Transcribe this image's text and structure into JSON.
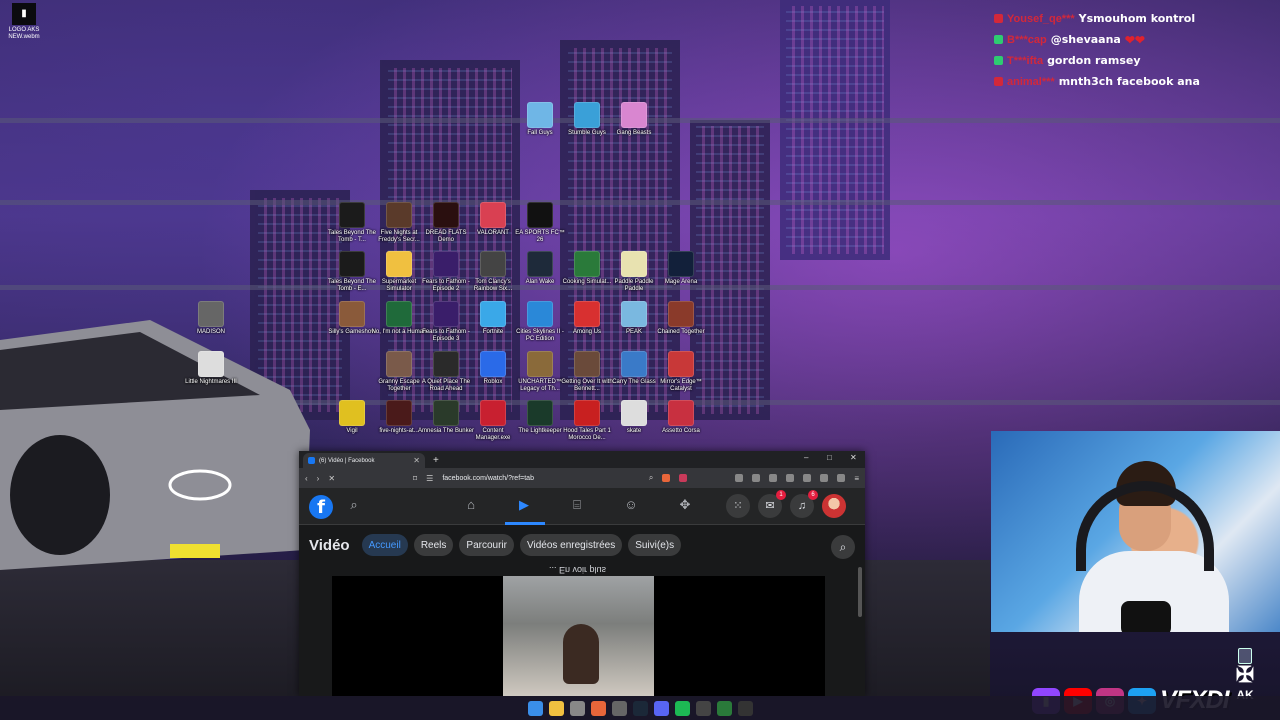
{
  "desktop": {
    "logo_icon_label": "LOGO AKS NEW.webm",
    "icons": [
      {
        "label": "Fall Guys",
        "color": "#6fb6e6"
      },
      {
        "label": "Stumble Guys",
        "color": "#3aa0d8"
      },
      {
        "label": "Gang Beasts",
        "color": "#d986d0"
      },
      {
        "label": "Tales Beyond The Tomb - T...",
        "color": "#1b1b1b"
      },
      {
        "label": "Five Nights at Freddy's Secr...",
        "color": "#5a3a2a"
      },
      {
        "label": "DREAD FLATS Demo",
        "color": "#2a0f0f"
      },
      {
        "label": "VALORANT",
        "color": "#d94052"
      },
      {
        "label": "EA SPORTS FC™ 26",
        "color": "#111"
      },
      {
        "label": "Tales Beyond The Tomb - E...",
        "color": "#1b1b1b"
      },
      {
        "label": "Supermarket Simulator",
        "color": "#f0c040"
      },
      {
        "label": "Fears to Fathom - Episode 2",
        "color": "#3a1e6a"
      },
      {
        "label": "Tom Clancy's Rainbow Six...",
        "color": "#444"
      },
      {
        "label": "Alan Wake",
        "color": "#1e2a3a"
      },
      {
        "label": "Cooking Simulat...",
        "color": "#2a7a3a"
      },
      {
        "label": "Paddle Paddle Paddle",
        "color": "#e8e2b0"
      },
      {
        "label": "Mage Arena",
        "color": "#12203a"
      },
      {
        "label": "MADISON",
        "color": "#666"
      },
      {
        "label": "Silly's Gameshow",
        "color": "#8a5a3a"
      },
      {
        "label": "No, I'm not a Human",
        "color": "#1f6a3a"
      },
      {
        "label": "Fears to Fathom - Episode 3",
        "color": "#3a1e6a"
      },
      {
        "label": "Fortnite",
        "color": "#3aa8e8"
      },
      {
        "label": "Cities Skylines II - PC Edition",
        "color": "#2a88d8"
      },
      {
        "label": "Among Us",
        "color": "#d83030"
      },
      {
        "label": "PEAK",
        "color": "#7ab8e0"
      },
      {
        "label": "Chained Together",
        "color": "#8a3a2a"
      },
      {
        "label": "Little Nightmares III",
        "color": "#ddd"
      },
      {
        "label": "Granny Escape Together",
        "color": "#7a5a4a"
      },
      {
        "label": "A Quiet Place The Road Ahead",
        "color": "#2a2a2a"
      },
      {
        "label": "Roblox",
        "color": "#2a6ae8"
      },
      {
        "label": "UNCHARTED™ Legacy of Th...",
        "color": "#8a6a3a"
      },
      {
        "label": "Getting Over It with Bennett...",
        "color": "#6a4a3a"
      },
      {
        "label": "Carry The Glass",
        "color": "#3a7ac8"
      },
      {
        "label": "Mirror's Edge™ Catalyst",
        "color": "#c83838"
      },
      {
        "label": "Vigil",
        "color": "#e0c020"
      },
      {
        "label": "five-nights-at...",
        "color": "#4a1a1a"
      },
      {
        "label": "Amnesia The Bunker",
        "color": "#2a3a2a"
      },
      {
        "label": "Content Manager.exe",
        "color": "#c82030"
      },
      {
        "label": "The Lightkeeper",
        "color": "#1a3a2a"
      },
      {
        "label": "Hood Tales Part 1 Morocco De...",
        "color": "#c82020"
      },
      {
        "label": "skate",
        "color": "#ddd"
      },
      {
        "label": "Assetto Corsa",
        "color": "#c83040"
      }
    ]
  },
  "chat": {
    "lines": [
      {
        "user": "Yousef_qe***",
        "message": "Ysmouhom kontrol",
        "emote": ""
      },
      {
        "user": "B***cap",
        "message": "@shevaana",
        "emote": "❤❤"
      },
      {
        "user": "T***ifta",
        "message": "gordon ramsey",
        "emote": ""
      },
      {
        "user": "animal***",
        "message": "mnth3ch facebook ana",
        "emote": ""
      }
    ]
  },
  "browser": {
    "tab_title": "(6) Vidéo | Facebook",
    "new_tab": "+",
    "url": "facebook.com/watch/?ref=tab",
    "window_controls": {
      "minimize": "–",
      "maximize": "□",
      "close": "✕"
    },
    "nav_badges": {
      "messenger": "1",
      "notifications": "6"
    }
  },
  "facebook": {
    "logo": "f",
    "video_title": "Vidéo",
    "tabs": [
      "Accueil",
      "Reels",
      "Parcourir",
      "Vidéos enregistrées",
      "Suivi(e)s"
    ],
    "selected_tab": "Accueil",
    "caption": "... En voir plus"
  },
  "overlay": {
    "brand": "VFXDI",
    "ak_logo": "AK"
  },
  "colors": {
    "facebook_blue": "#1877f2",
    "chat_username": "#d3283a"
  }
}
